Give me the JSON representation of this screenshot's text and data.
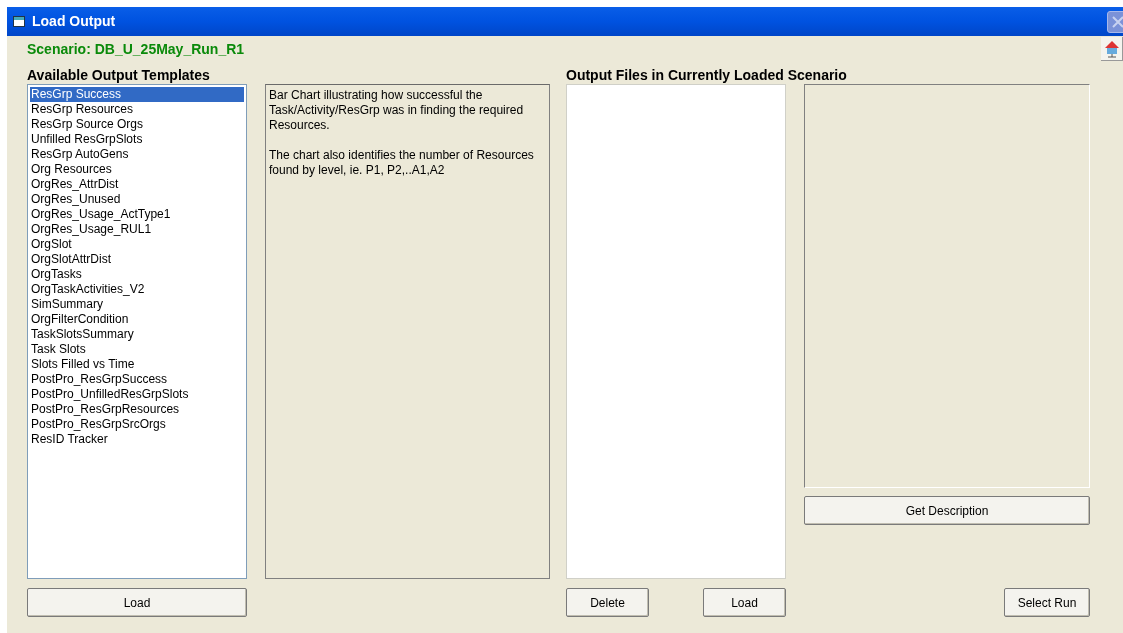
{
  "window": {
    "title": "Load Output"
  },
  "scenario": "Scenario: DB_U_25May_Run_R1",
  "templates": {
    "heading": "Available Output Templates",
    "items": [
      {
        "label": "ResGrp Success",
        "selected": true
      },
      {
        "label": "ResGrp Resources",
        "selected": false
      },
      {
        "label": "ResGrp Source Orgs",
        "selected": false
      },
      {
        "label": "Unfilled ResGrpSlots",
        "selected": false
      },
      {
        "label": "ResGrp AutoGens",
        "selected": false
      },
      {
        "label": "Org Resources",
        "selected": false
      },
      {
        "label": "OrgRes_AttrDist",
        "selected": false
      },
      {
        "label": "OrgRes_Unused",
        "selected": false
      },
      {
        "label": "OrgRes_Usage_ActType1",
        "selected": false
      },
      {
        "label": "OrgRes_Usage_RUL1",
        "selected": false
      },
      {
        "label": "OrgSlot",
        "selected": false
      },
      {
        "label": "OrgSlotAttrDist",
        "selected": false
      },
      {
        "label": "OrgTasks",
        "selected": false
      },
      {
        "label": "OrgTaskActivities_V2",
        "selected": false
      },
      {
        "label": "SimSummary",
        "selected": false
      },
      {
        "label": "OrgFilterCondition",
        "selected": false
      },
      {
        "label": "TaskSlotsSummary",
        "selected": false
      },
      {
        "label": "Task Slots",
        "selected": false
      },
      {
        "label": "Slots Filled vs Time",
        "selected": false
      },
      {
        "label": "PostPro_ResGrpSuccess",
        "selected": false
      },
      {
        "label": "PostPro_UnfilledResGrpSlots",
        "selected": false
      },
      {
        "label": "PostPro_ResGrpResources",
        "selected": false
      },
      {
        "label": "PostPro_ResGrpSrcOrgs",
        "selected": false
      },
      {
        "label": "ResID Tracker",
        "selected": false
      }
    ],
    "load_button": "Load"
  },
  "description": [
    "Bar Chart illustrating how successful the Task/Activity/ResGrp was in finding the required Resources.",
    "The chart also identifies the number of Resources found by level, ie. P1, P2,..A1,A2"
  ],
  "output_files": {
    "heading": "Output Files in Currently Loaded Scenario",
    "delete_button": "Delete",
    "load_button": "Load"
  },
  "get_description_button": "Get Description",
  "select_run_button": "Select Run"
}
